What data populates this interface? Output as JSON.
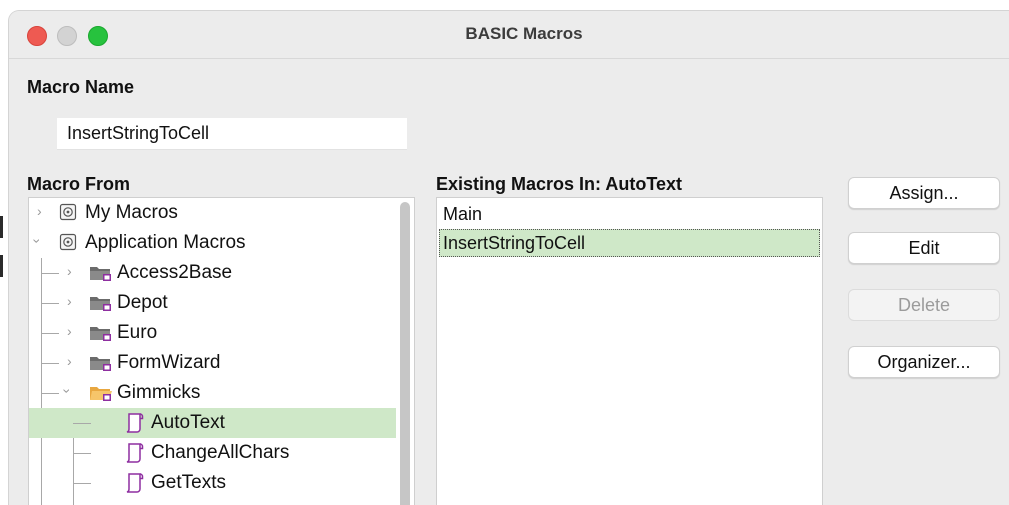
{
  "window": {
    "title": "BASIC Macros"
  },
  "macro_name": {
    "label": "Macro Name",
    "value": "InsertStringToCell"
  },
  "macro_from": {
    "label": "Macro From",
    "items": [
      {
        "label": "My Macros",
        "icon": "library-icon",
        "expanded": false,
        "selected": false
      },
      {
        "label": "Application Macros",
        "icon": "library-icon",
        "expanded": true,
        "selected": false
      },
      {
        "label": "Access2Base",
        "icon": "folder-icon",
        "expanded": false,
        "selected": false
      },
      {
        "label": "Depot",
        "icon": "folder-icon",
        "expanded": false,
        "selected": false
      },
      {
        "label": "Euro",
        "icon": "folder-icon",
        "expanded": false,
        "selected": false
      },
      {
        "label": "FormWizard",
        "icon": "folder-icon",
        "expanded": false,
        "selected": false
      },
      {
        "label": "Gimmicks",
        "icon": "open-folder-icon",
        "expanded": true,
        "selected": false
      },
      {
        "label": "AutoText",
        "icon": "module-icon",
        "expanded": false,
        "selected": true
      },
      {
        "label": "ChangeAllChars",
        "icon": "module-icon",
        "expanded": false,
        "selected": false
      },
      {
        "label": "GetTexts",
        "icon": "module-icon",
        "expanded": false,
        "selected": false
      }
    ]
  },
  "existing_macros": {
    "label": "Existing Macros In: AutoText",
    "items": [
      {
        "label": "Main",
        "selected": false
      },
      {
        "label": "InsertStringToCell",
        "selected": true
      }
    ]
  },
  "buttons": {
    "assign": "Assign...",
    "edit": "Edit",
    "delete": "Delete",
    "organizer": "Organizer..."
  },
  "colors": {
    "selection": "#cfe8c8",
    "close": "#ee5a52",
    "minimize_disabled": "#d3d3d3",
    "zoom": "#27c23e"
  }
}
